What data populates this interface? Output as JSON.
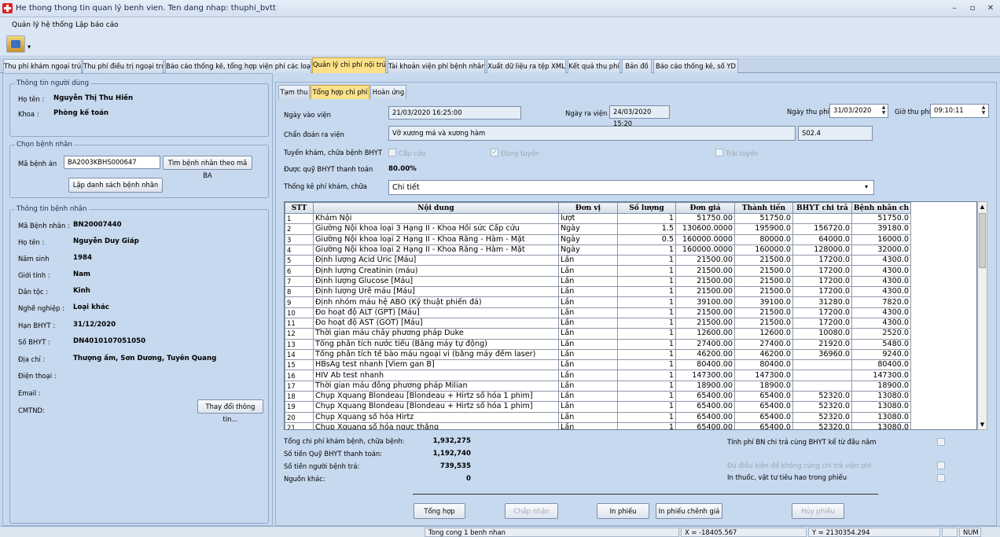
{
  "window": {
    "title": "He thong thong tin quan lý benh vien. Ten dang nhap: thuphi_bvtt",
    "min": "–",
    "restore": "▫",
    "close": "✕"
  },
  "menu": [
    "Quản lý hệ thống",
    "Lập báo cáo"
  ],
  "main_tabs": [
    "Thu phí khám ngoại trú",
    "Thu phí điều trị ngoại trú",
    "Báo cáo thống kê, tổng hợp viện phí các loại",
    "Quản lý chi phí nội trú",
    "Tài khoản viện phí bệnh nhân",
    "Xuất dữ liệu ra tệp XML",
    "Kết quả thu phí",
    "Bản đồ",
    "Báo cáo thống kê, số YD"
  ],
  "user_info": {
    "title": "Thông tin người dùng",
    "name_label": "Họ tên :",
    "name": "Nguyễn Thị Thu Hiền",
    "dept_label": "Khoa :",
    "dept": "Phòng kế toán"
  },
  "select_patient": {
    "title": "Chọn bệnh nhân",
    "record_label": "Mã bệnh án",
    "record_value": "BA2003KBHS000647",
    "find_button": "Tìm bệnh nhân theo mã BA",
    "list_button": "Lập danh sách bệnh nhân"
  },
  "patient_info": {
    "title": "Thông tin bệnh nhân",
    "fields": [
      {
        "label": "Mã Bệnh nhân :",
        "value": "BN20007440"
      },
      {
        "label": "Họ tên :",
        "value": "Nguyễn Duy Giáp"
      },
      {
        "label": "Năm sinh",
        "value": "1984"
      },
      {
        "label": "Giới tính :",
        "value": "Nam"
      },
      {
        "label": "Dân tộc :",
        "value": "Kinh"
      },
      {
        "label": "Nghề nghiệp :",
        "value": "Loại khác"
      },
      {
        "label": "Hạn BHYT :",
        "value": "31/12/2020"
      },
      {
        "label": "Số BHYT :",
        "value": "DN4010107051050"
      },
      {
        "label": "Địa chỉ :",
        "value": "Thượng ấm, Sơn Dương, Tuyên Quang"
      },
      {
        "label": "Điện thoại :",
        "value": ""
      },
      {
        "label": "Email :",
        "value": ""
      },
      {
        "label": "CMTND:",
        "value": ""
      }
    ],
    "change_button": "Thay đổi thông tin..."
  },
  "sub_tabs": [
    "Tạm thu",
    "Tổng hợp chi phí",
    "Hoàn ứng"
  ],
  "form": {
    "admit_label": "Ngày vào viện",
    "admit_value": "21/03/2020 16:25:00",
    "discharge_label": "Ngày ra viện",
    "discharge_value": "24/03/2020 15:20",
    "pay_date_label": "Ngày thu phí",
    "pay_date_value": "31/03/2020",
    "pay_time_label": "Giờ thu phí",
    "pay_time_value": "09:10:11",
    "diagnosis_label": "Chẩn đoán ra viện",
    "diagnosis_value": "Vỡ xương má và xương hàm",
    "diagnosis_code": "S02.4",
    "route_label": "Tuyến khám, chữa bệnh BHYT",
    "route_emergency": "Cấp cứu",
    "route_correct": "Đúng tuyến",
    "route_wrong": "Trái tuyến",
    "fund_label": "Được quỹ BHYT thanh toán",
    "fund_value": "80.00%",
    "stat_label": "Thống kê phí khám, chữa",
    "stat_value": "Chi tiết"
  },
  "table": {
    "headers": [
      "STT",
      "Nội dung",
      "Đơn vị",
      "Số lượng",
      "Đơn giá",
      "Thành tiền",
      "BHYT chi trả",
      "Bệnh nhân ch"
    ],
    "rows": [
      [
        "1",
        "Khám Nội",
        "lượt",
        "1",
        "51750.00",
        "51750.0",
        "",
        "51750.0"
      ],
      [
        "2",
        "Giường Nội khoa loại 3 Hạng II - Khoa Hồi sức Cấp cứu",
        "Ngày",
        "1.5",
        "130600.0000",
        "195900.0",
        "156720.0",
        "39180.0"
      ],
      [
        "3",
        "Giường Nội khoa loại 2 Hạng II - Khoa Răng - Hàm - Mặt",
        "Ngày",
        "0.5",
        "160000.0000",
        "80000.0",
        "64000.0",
        "16000.0"
      ],
      [
        "4",
        "Giường Nội khoa loại 2 Hạng II - Khoa Răng - Hàm - Mặt",
        "Ngày",
        "1",
        "160000.0000",
        "160000.0",
        "128000.0",
        "32000.0"
      ],
      [
        "5",
        "Định lượng Acid Uric [Máu]",
        "Lần",
        "1",
        "21500.00",
        "21500.0",
        "17200.0",
        "4300.0"
      ],
      [
        "6",
        "Định lượng Creatinin (máu)",
        "Lần",
        "1",
        "21500.00",
        "21500.0",
        "17200.0",
        "4300.0"
      ],
      [
        "7",
        "Định lượng Glucose [Máu]",
        "Lần",
        "1",
        "21500.00",
        "21500.0",
        "17200.0",
        "4300.0"
      ],
      [
        "8",
        "Định lượng Urê máu [Máu]",
        "Lần",
        "1",
        "21500.00",
        "21500.0",
        "17200.0",
        "4300.0"
      ],
      [
        "9",
        "Định nhóm máu hệ ABO (Kỹ thuật phiến đá)",
        "Lần",
        "1",
        "39100.00",
        "39100.0",
        "31280.0",
        "7820.0"
      ],
      [
        "10",
        "Đo hoạt độ ALT (GPT) [Máu]",
        "Lần",
        "1",
        "21500.00",
        "21500.0",
        "17200.0",
        "4300.0"
      ],
      [
        "11",
        "Đo hoạt độ AST (GOT) [Máu]",
        "Lần",
        "1",
        "21500.00",
        "21500.0",
        "17200.0",
        "4300.0"
      ],
      [
        "12",
        "Thời gian máu chảy phương pháp Duke",
        "Lần",
        "1",
        "12600.00",
        "12600.0",
        "10080.0",
        "2520.0"
      ],
      [
        "13",
        "Tổng phân tích nước tiểu (Bằng máy tự động)",
        "Lần",
        "1",
        "27400.00",
        "27400.0",
        "21920.0",
        "5480.0"
      ],
      [
        "14",
        "Tổng phân tích tế bào máu ngoại vi (bằng máy đếm laser)",
        "Lần",
        "1",
        "46200.00",
        "46200.0",
        "36960.0",
        "9240.0"
      ],
      [
        "15",
        "HBsAg test nhanh [Viem gan B]",
        "Lần",
        "1",
        "80400.00",
        "80400.0",
        "",
        "80400.0"
      ],
      [
        "16",
        "HIV Ab test nhanh",
        "Lần",
        "1",
        "147300.00",
        "147300.0",
        "",
        "147300.0"
      ],
      [
        "17",
        "Thời gian máu đông phương pháp Milian",
        "Lần",
        "1",
        "18900.00",
        "18900.0",
        "",
        "18900.0"
      ],
      [
        "18",
        "Chụp Xquang Blondeau [Blondeau + Hirtz số hóa 1 phim]",
        "Lần",
        "1",
        "65400.00",
        "65400.0",
        "52320.0",
        "13080.0"
      ],
      [
        "19",
        "Chụp Xquang Blondeau [Blondeau + Hirtz số hóa 1 phim]",
        "Lần",
        "1",
        "65400.00",
        "65400.0",
        "52320.0",
        "13080.0"
      ],
      [
        "20",
        "Chụp Xquang số hóa Hirtz",
        "Lần",
        "1",
        "65400.00",
        "65400.0",
        "52320.0",
        "13080.0"
      ],
      [
        "21",
        "Chụp Xquang số hóa ngực thẳng",
        "Lần",
        "1",
        "65400.00",
        "65400.0",
        "52320.0",
        "13080.0"
      ]
    ]
  },
  "summary": {
    "total_label": "Tổng chi phí khám bệnh, chữa bệnh:",
    "total_value": "1,932,275",
    "insurance_label": "Số tiền Quỹ BHYT thanh toán:",
    "insurance_value": "1,192,740",
    "patient_label": "Số tiền người bệnh trả:",
    "patient_value": "739,535",
    "other_label": "Nguồn khác:",
    "other_value": "0",
    "opt1": "Tính phí BN chi trả cùng BHYT kể từ đầu năm",
    "opt2": "Đủ điều kiện để không cùng chi trả viện phí",
    "opt3": "In thuốc, vật tư tiêu hao trong phiếu"
  },
  "actions": {
    "summarize": "Tổng hợp",
    "accept": "Chấp nhận",
    "print": "In phiếu",
    "print_diff": "In phiếu chênh giá",
    "cancel": "Hủy phiếu"
  },
  "status": {
    "msg": "Tong cong 1 benh nhan",
    "x": "X = -18405.567",
    "y": "Y = 2130354.294",
    "num": "NUM"
  }
}
